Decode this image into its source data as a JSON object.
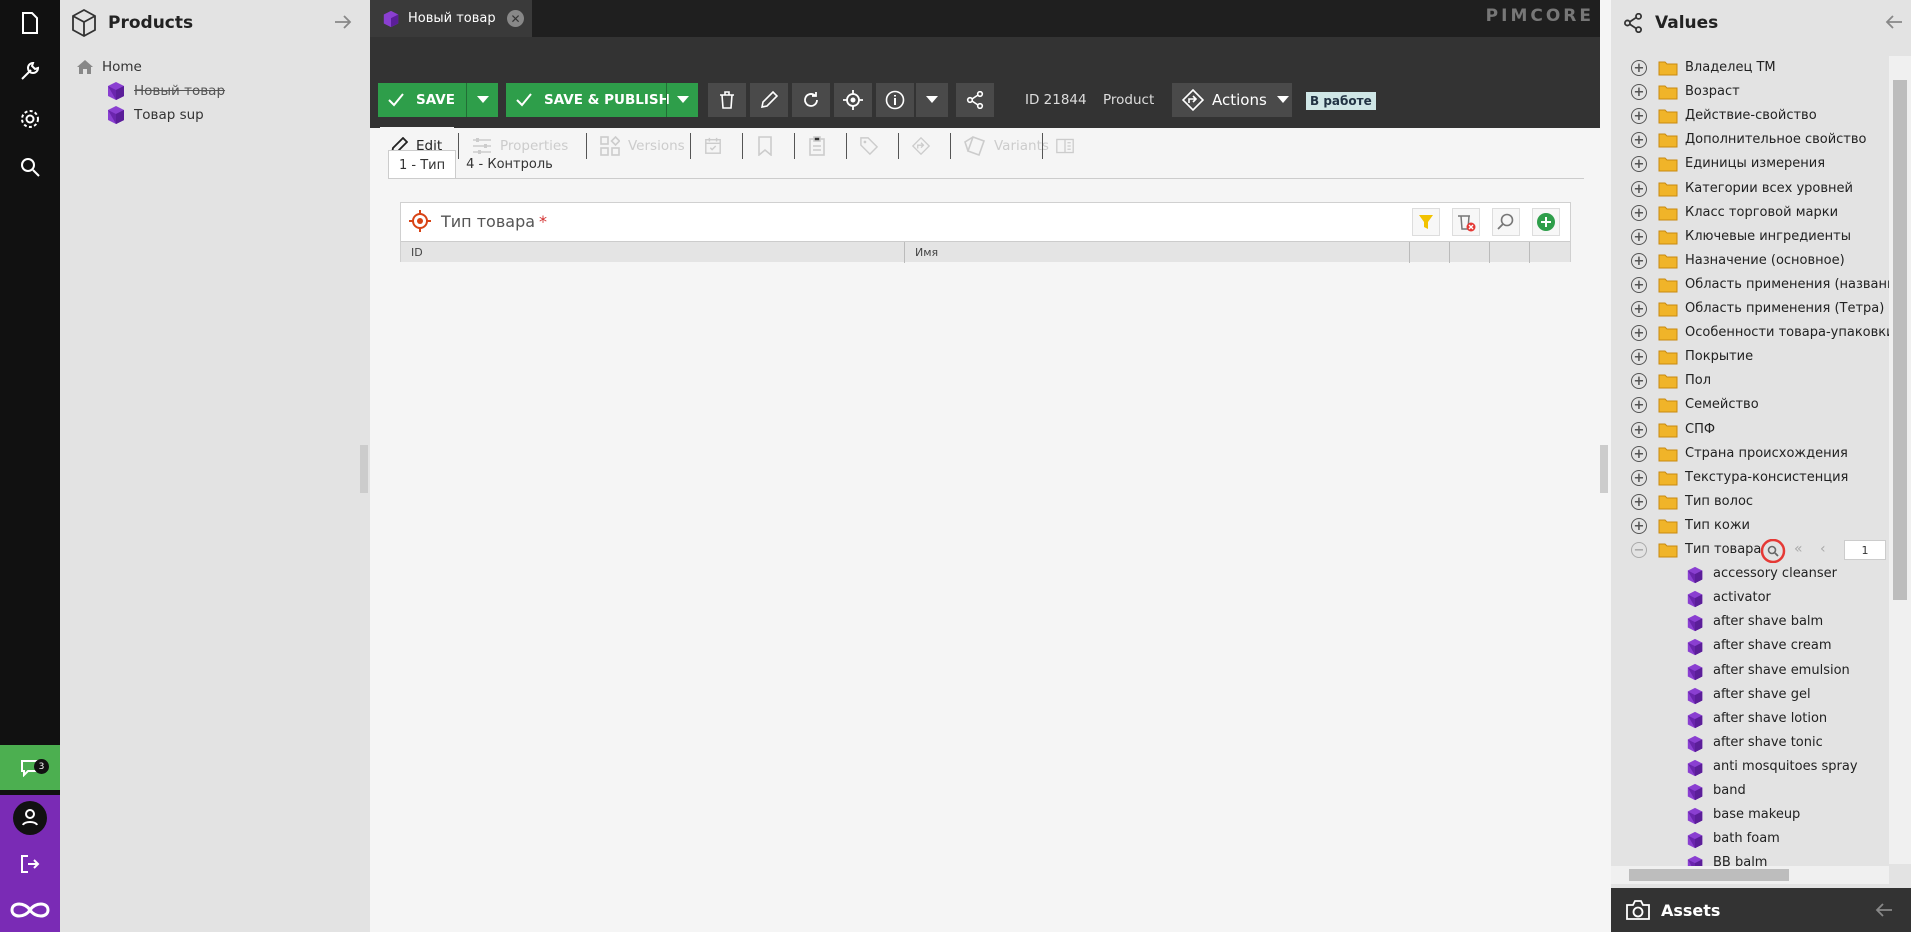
{
  "leftbar": {
    "notif_count": "3"
  },
  "tree": {
    "title": "Products",
    "items": [
      {
        "label": "Home"
      },
      {
        "label": "Новый товар"
      },
      {
        "label": "Товар sup"
      }
    ]
  },
  "doc": {
    "tab_label": "Новый товар",
    "brand": "PIMCORE"
  },
  "toolbar": {
    "save": "SAVE",
    "save_publish": "SAVE & PUBLISH",
    "id": "ID 21844",
    "type": "Product",
    "actions": "Actions",
    "status": "В работе"
  },
  "tabs": [
    "Edit",
    "Properties",
    "Versions",
    "Variants"
  ],
  "subtabs": [
    "1 - Тип",
    "4 - Контроль"
  ],
  "field": {
    "label": "Тип товара",
    "required": "*",
    "columns": [
      "ID",
      "Имя"
    ]
  },
  "values": {
    "title": "Values",
    "folders": [
      "Владелец ТМ",
      "Возраст",
      "Действие-свойство",
      "Дополнительное свойство",
      "Единицы измерения",
      "Категории всех уровней",
      "Класс торговой марки",
      "Ключевые ингредиенты",
      "Назначение (основное)",
      "Область применения (название",
      "Область применения (Тетра)",
      "Особенности товара-упаковки",
      "Покрытие",
      "Пол",
      "Семейство",
      "СПФ",
      "Страна происхождения",
      "Текстура-консистенция",
      "Тип волос",
      "Тип кожи",
      "Тип товара"
    ],
    "page": "1",
    "children": [
      "accessory cleanser",
      "activator",
      "after shave balm",
      "after shave cream",
      "after shave emulsion",
      "after shave gel",
      "after shave lotion",
      "after shave tonic",
      "anti mosquitoes spray",
      "band",
      "base makeup",
      "bath foam",
      "BB balm"
    ]
  },
  "assets": {
    "title": "Assets"
  }
}
